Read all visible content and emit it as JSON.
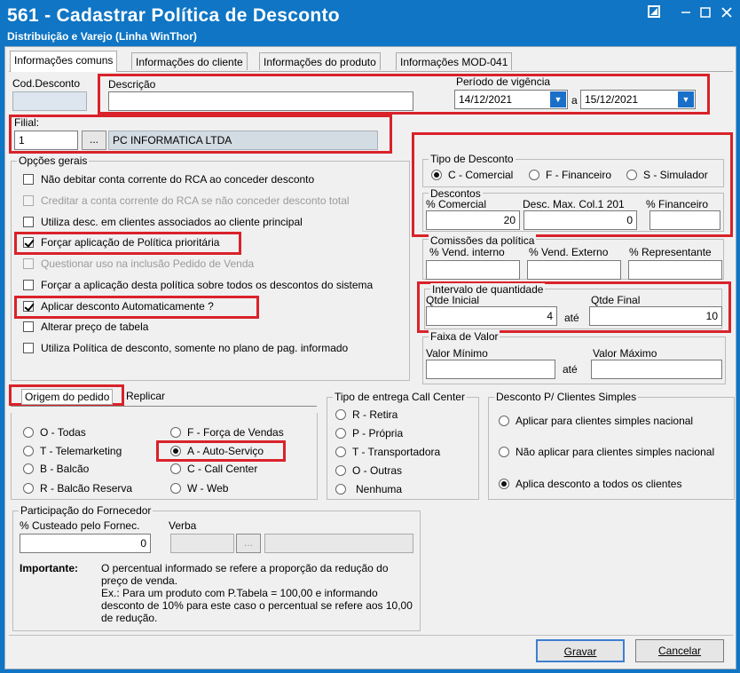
{
  "window": {
    "title": "561 - Cadastrar Política de Desconto",
    "subtitle": "Distribuição e Varejo (Linha WinThor)"
  },
  "tabs": [
    "Informações comuns",
    "Informações do cliente",
    "Informações do produto",
    "Informações MOD-041"
  ],
  "header": {
    "cod_label": "Cod.Desconto",
    "cod_value": "",
    "desc_label": "Descrição",
    "desc_value": "",
    "periodo_label": "Período de vigência",
    "data_inicio": "14/12/2021",
    "periodo_sep": "a",
    "data_fim": "15/12/2021",
    "filial_label": "Filial:",
    "filial_code": "1",
    "filial_browse": "...",
    "filial_name": "PC INFORMATICA LTDA"
  },
  "opcoes": {
    "title": "Opções gerais",
    "items": [
      {
        "label": "Não debitar conta corrente do RCA ao conceder desconto",
        "checked": false,
        "enabled": true
      },
      {
        "label": "Creditar a conta corrente do RCA se não conceder desconto total",
        "checked": false,
        "enabled": false
      },
      {
        "label": "Utiliza desc. em clientes associados ao cliente principal",
        "checked": false,
        "enabled": true
      },
      {
        "label": "Forçar aplicação de Política prioritária",
        "checked": true,
        "enabled": true
      },
      {
        "label": "Questionar uso na inclusão Pedido de Venda",
        "checked": false,
        "enabled": false
      },
      {
        "label": "Forçar a aplicação desta política sobre todos os descontos do sistema",
        "checked": false,
        "enabled": true
      },
      {
        "label": "Aplicar desconto Automaticamente ?",
        "checked": true,
        "enabled": true
      },
      {
        "label": "Alterar preço de tabela",
        "checked": false,
        "enabled": true
      },
      {
        "label": "Utiliza Política de desconto, somente no plano de pag. informado",
        "checked": false,
        "enabled": true
      }
    ]
  },
  "tipo_desconto": {
    "title": "Tipo de Desconto",
    "options": [
      "C - Comercial",
      "F - Financeiro",
      "S - Simulador"
    ],
    "selected": "C - Comercial"
  },
  "descontos": {
    "title": "Descontos",
    "comercial_label": "% Comercial",
    "comercial_value": "20",
    "max_label": "Desc. Max. Col.1 201",
    "max_value": "0",
    "financeiro_label": "% Financeiro",
    "financeiro_value": ""
  },
  "comissoes": {
    "title": "Comissões da política",
    "interno_label": "% Vend. interno",
    "externo_label": "% Vend. Externo",
    "representante_label": "% Representante"
  },
  "intervalo": {
    "title": "Intervalo de quantidade",
    "inicial_label": "Qtde Inicial",
    "inicial_value": "4",
    "ate": "até",
    "final_label": "Qtde Final",
    "final_value": "10"
  },
  "faixa": {
    "title": "Faixa de Valor",
    "min_label": "Valor Mínimo",
    "ate": "até",
    "max_label": "Valor Máximo"
  },
  "origem": {
    "tab1": "Origem do pedido",
    "tab2": "Replicar",
    "options": [
      "O - Todas",
      "T - Telemarketing",
      "B - Balcão",
      "R - Balcão Reserva",
      "F - Força de Vendas",
      "A - Auto-Serviço",
      "C - Call Center",
      "W - Web"
    ],
    "selected": "A - Auto-Serviço"
  },
  "entrega": {
    "title": "Tipo de entrega Call Center",
    "options": [
      "R - Retira",
      "P - Própria",
      "T - Transportadora",
      "O - Outras",
      "Nenhuma"
    ]
  },
  "simples": {
    "title": "Desconto P/ Clientes Simples",
    "options": [
      "Aplicar para clientes simples nacional",
      "Não aplicar para clientes simples nacional",
      "Aplica desconto a todos os clientes"
    ],
    "selected": "Aplica desconto a todos os clientes"
  },
  "fornecedor": {
    "title": "Participação do Fornecedor",
    "custeado_label": "% Custeado pelo Fornec.",
    "custeado_value": "0",
    "verba_label": "Verba",
    "verba_browse": "...",
    "importante_label": "Importante:",
    "importante_text": "O percentual informado se refere a proporção da redução do preço de venda.",
    "exemplo_text": "Ex.: Para um produto com P.Tabela = 100,00 e informando desconto de 10% para este caso o percentual se refere aos 10,00 de redução."
  },
  "buttons": {
    "gravar": "Gravar",
    "cancelar": "Cancelar"
  },
  "colors": {
    "titlebar": "#0f75c4",
    "highlight": "#d9222a",
    "dropdown": "#1a6fc8"
  }
}
